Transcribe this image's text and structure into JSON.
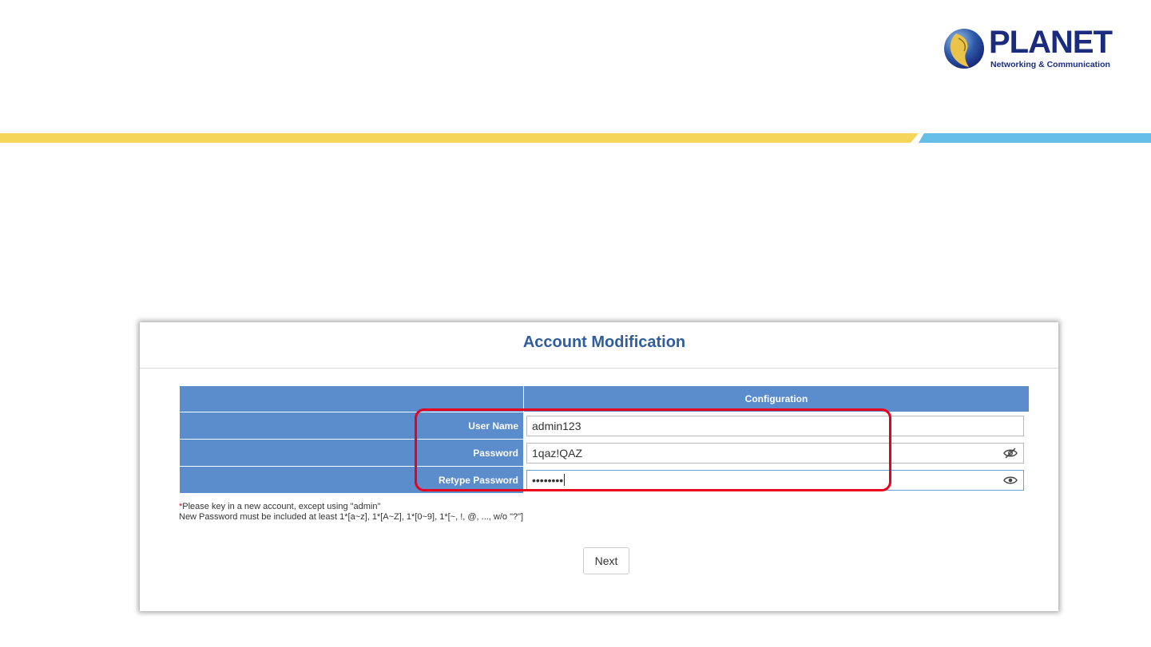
{
  "brand": {
    "name": "PLANET",
    "tagline": "Networking & Communication",
    "logo_icon": "globe-face-logo"
  },
  "colors": {
    "stripe_yellow": "#f5d55a",
    "stripe_blue": "#66bde8",
    "header_blue": "#5b8ccb",
    "title_blue": "#2f5d9e",
    "highlight_red": "#e8001c"
  },
  "form": {
    "title": "Account Modification",
    "column_header": "Configuration",
    "fields": [
      {
        "label": "User Name",
        "value": "admin123",
        "icon": ""
      },
      {
        "label": "Password",
        "value": "1qaz!QAZ",
        "icon": "eye-slash-icon"
      },
      {
        "label": "Retype Password",
        "value": "••••••••",
        "icon": "eye-icon"
      }
    ],
    "note_asterisk": "*",
    "note_line1": "Please key in a new account, except using \"admin\"",
    "note_line2": "New Password must be included at least 1*[a~z], 1*[A~Z], 1*[0~9], 1*[~, !, @, ..., w/o \"?\"]",
    "next_label": "Next"
  }
}
